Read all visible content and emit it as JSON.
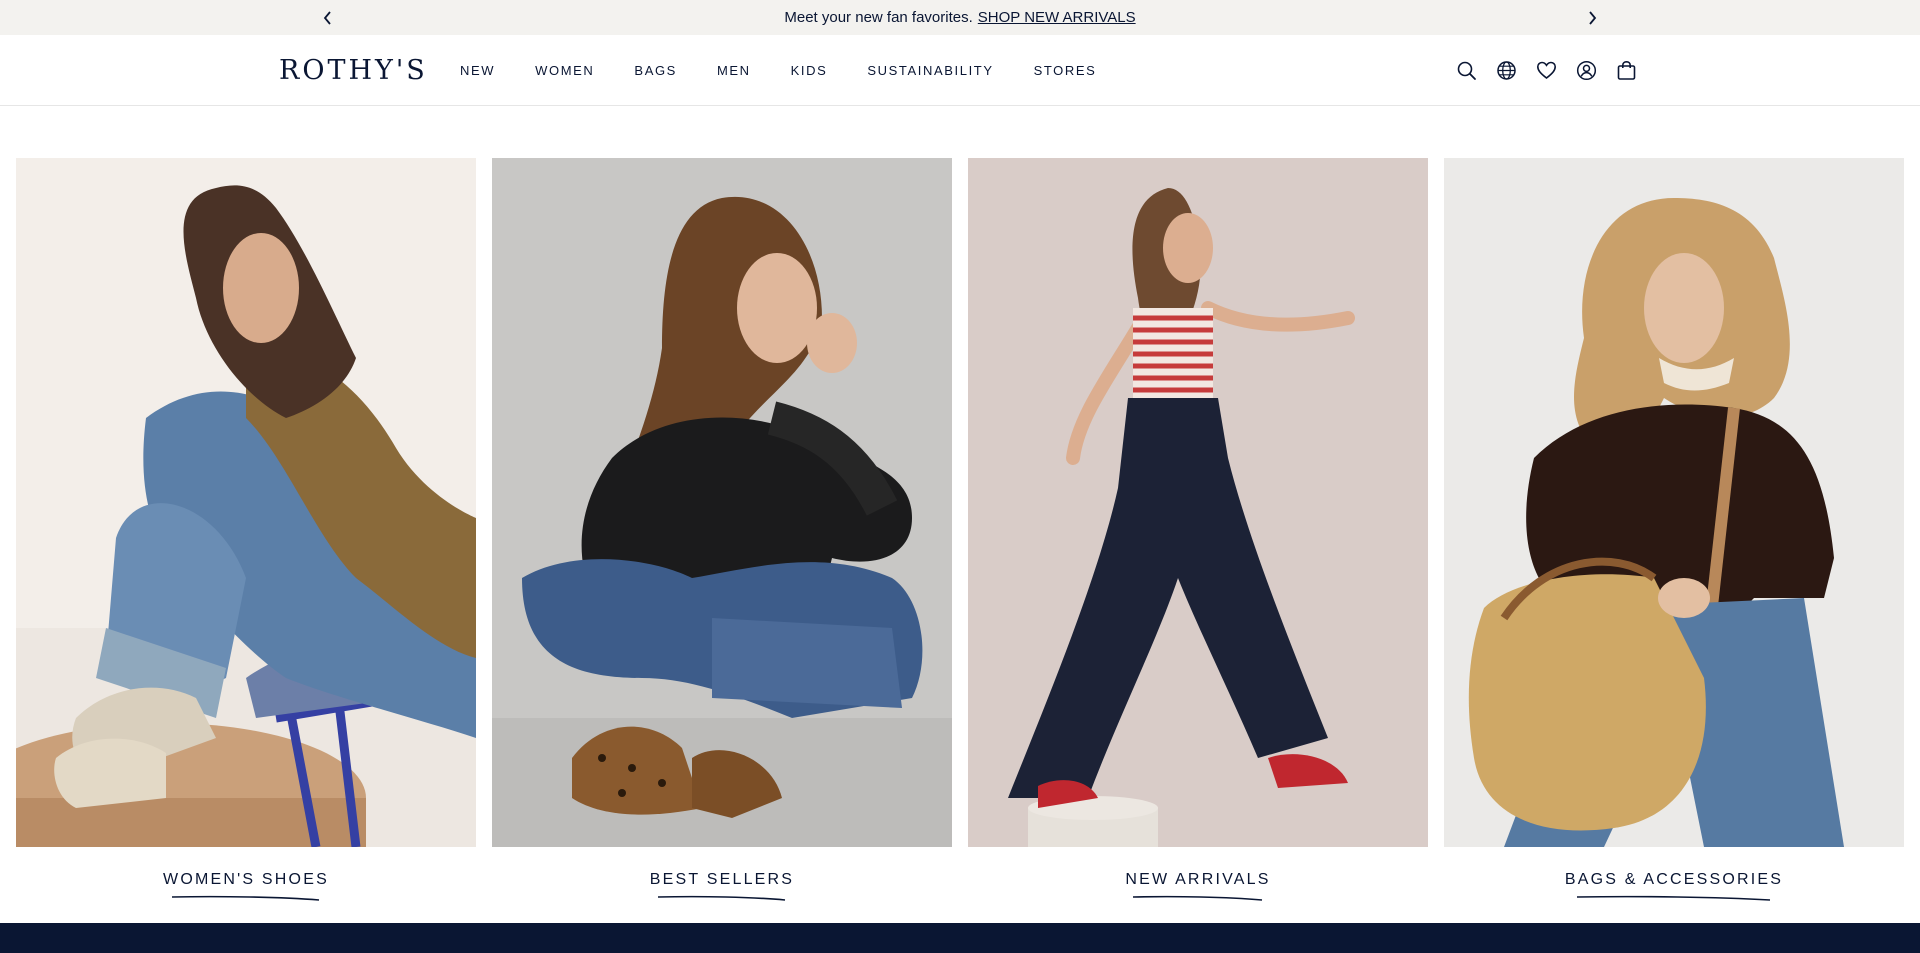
{
  "announcement": {
    "message": "Meet your new fan favorites.",
    "link_label": "SHOP NEW ARRIVALS"
  },
  "header": {
    "logo": "ROTHY'S",
    "nav": [
      "NEW",
      "WOMEN",
      "BAGS",
      "MEN",
      "KIDS",
      "SUSTAINABILITY",
      "STORES"
    ],
    "icons": [
      "search-icon",
      "globe-icon",
      "heart-icon",
      "account-icon",
      "bag-icon"
    ]
  },
  "tiles": [
    {
      "label": "WOMEN'S SHOES",
      "bg": "#f3eee9"
    },
    {
      "label": "BEST SELLERS",
      "bg": "#c8c7c5"
    },
    {
      "label": "NEW ARRIVALS",
      "bg": "#d9ccc8"
    },
    {
      "label": "BAGS & ACCESSORIES",
      "bg": "#ebeae8"
    }
  ],
  "colors": {
    "navy": "#0a1633",
    "announce_bg": "#f3f2ef"
  }
}
